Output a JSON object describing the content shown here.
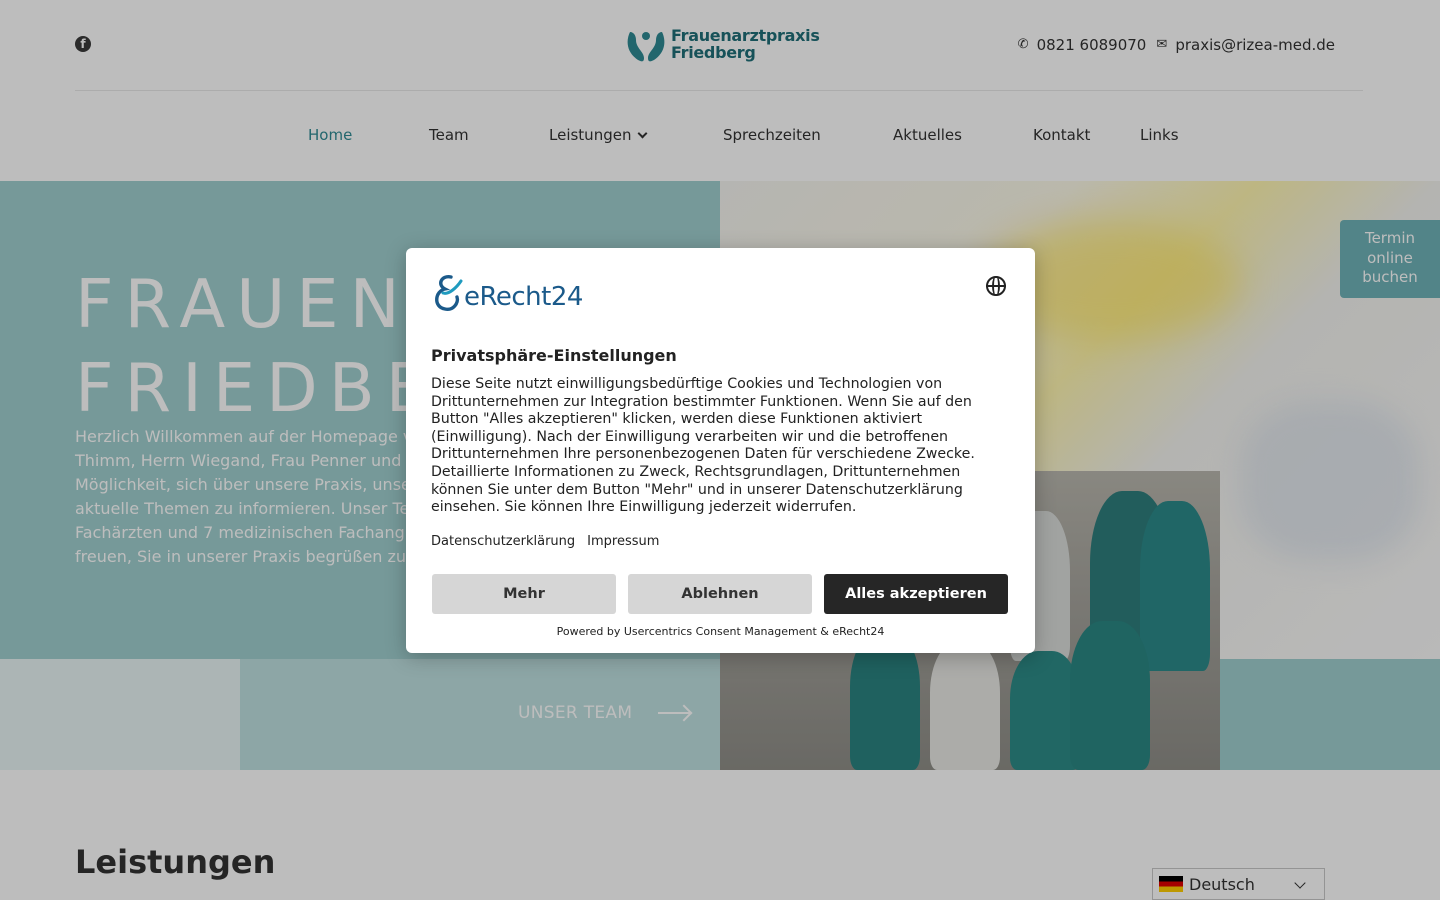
{
  "header": {
    "logo_line1": "Frauenarztpraxis",
    "logo_line2": "Friedberg",
    "phone": "0821 6089070",
    "email": "praxis@rizea-med.de",
    "brand_color": "#1f6f78",
    "icons": [
      "facebook-icon",
      "phone-icon",
      "envelope-icon"
    ]
  },
  "nav": {
    "items": [
      "Home",
      "Team",
      "Leistungen",
      "Sprechzeiten",
      "Aktuelles",
      "Kontakt",
      "Links"
    ],
    "active": "Home",
    "active_color": "#2f8a94"
  },
  "hero": {
    "title_line1": "FRAUENA",
    "title_line2": "FRIEDBE",
    "paragraph": "Herzlich Willkommen auf der Homepage v\nThimm, Herrn Wiegand, Frau Penner und F\nMöglichkeit, sich über unsere Praxis, unser\naktuelle Themen zu informieren. Unser Tea\nFachärzten und 7 medizinischen Fachang\nfreuen, Sie in unserer Praxis begrüßen zu d",
    "team_link": "UNSER TEAM",
    "termin_lines": [
      "Termin",
      "online",
      "buchen"
    ],
    "accent_color": "#9fcfcf"
  },
  "section": {
    "title": "Leistungen"
  },
  "language": {
    "selected": "Deutsch"
  },
  "consent": {
    "brand": "eRecht24",
    "title": "Privatsphäre-Einstellungen",
    "body": "Diese Seite nutzt einwilligungsbedürftige Cookies und Technologien von Drittunternehmen zur Integration bestimmter Funktionen. Wenn Sie auf den Button \"Alles akzeptieren\" klicken, werden diese Funktionen aktiviert (Einwilligung). Nach der Einwilligung verarbeiten wir und die betroffenen Drittunternehmen Ihre personenbezogenen Daten für verschiedene Zwecke. Detaillierte Informationen zu Zweck, Rechtsgrundlagen, Drittunternehmen können Sie unter dem Button \"Mehr\" und in unserer Datenschutzerklärung einsehen. Sie können Ihre Einwilligung jederzeit widerrufen.",
    "link_privacy": "Datenschutzerklärung",
    "link_imprint": "Impressum",
    "btn_more": "Mehr",
    "btn_decline": "Ablehnen",
    "btn_accept": "Alles akzeptieren",
    "powered": "Powered by Usercentrics Consent Management & eRecht24"
  }
}
